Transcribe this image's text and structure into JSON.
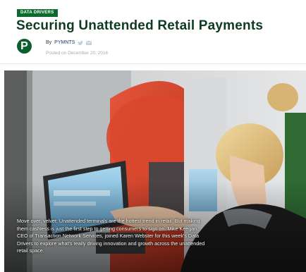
{
  "article": {
    "category": "DATA DRIVERS",
    "title": "Securing Unattended Retail Payments",
    "author_initial": "P",
    "byline_prefix": "By",
    "author": "PYMNTS",
    "posted": "Posted on December 20, 2016",
    "caption": "Move over, velvet: Unattended terminals are the hottest trend in retail. But making them cashless is just the first step to getting consumers to sign on. Mike Keegan, CEO of Transaction Network Services, joined Karen Webster for this week's Data Drivers to explore what's really driving innovation and growth across the unattended retail space."
  },
  "icons": [
    "twitter-icon",
    "email-icon"
  ],
  "colors": {
    "badge": "#0b6b2e",
    "headline": "#0f3a24",
    "avatar": "#0b5e2d",
    "author_link": "#1f3a6b",
    "date": "#aaaaaa"
  }
}
